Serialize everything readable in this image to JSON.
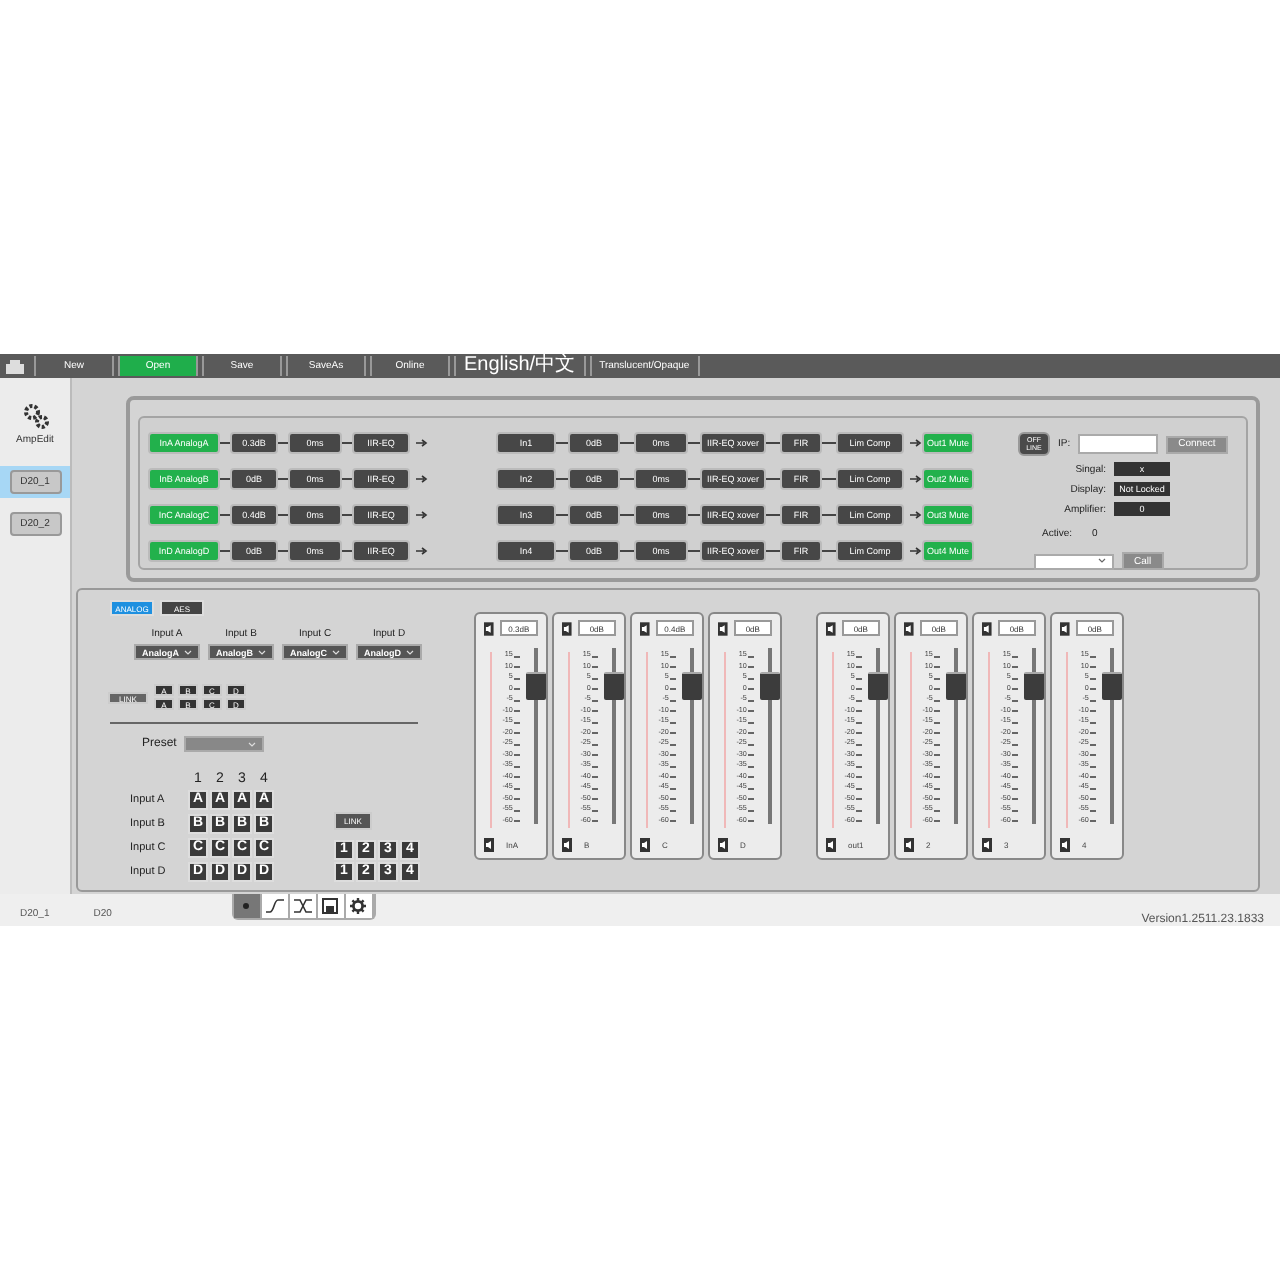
{
  "toolbar": {
    "items": [
      {
        "label": "New",
        "selected": false
      },
      {
        "label": "Open",
        "selected": true
      },
      {
        "label": "Save",
        "selected": false
      },
      {
        "label": "SaveAs",
        "selected": false
      },
      {
        "label": "Online",
        "selected": false
      },
      {
        "label": "English/中文",
        "selected": false
      },
      {
        "label": "Translucent/Opaque",
        "selected": false
      }
    ]
  },
  "sidebar": {
    "app_label": "AmpEdit",
    "devices": [
      {
        "label": "D20_1",
        "selected": true
      },
      {
        "label": "D20_2",
        "selected": false
      }
    ]
  },
  "routing": {
    "inputs": [
      {
        "source": "InA AnalogA",
        "gain": "0.3dB",
        "delay": "0ms",
        "eq": "IIR-EQ"
      },
      {
        "source": "InB AnalogB",
        "gain": "0dB",
        "delay": "0ms",
        "eq": "IIR-EQ"
      },
      {
        "source": "InC AnalogC",
        "gain": "0.4dB",
        "delay": "0ms",
        "eq": "IIR-EQ"
      },
      {
        "source": "InD AnalogD",
        "gain": "0dB",
        "delay": "0ms",
        "eq": "IIR-EQ"
      }
    ],
    "outputs": [
      {
        "input": "In1",
        "gain": "0dB",
        "delay": "0ms",
        "eq": "IIR-EQ xover",
        "fir": "FIR",
        "limiter": "Lim Comp",
        "mute": "Out1 Mute"
      },
      {
        "input": "In2",
        "gain": "0dB",
        "delay": "0ms",
        "eq": "IIR-EQ xover",
        "fir": "FIR",
        "limiter": "Lim Comp",
        "mute": "Out2 Mute"
      },
      {
        "input": "In3",
        "gain": "0dB",
        "delay": "0ms",
        "eq": "IIR-EQ xover",
        "fir": "FIR",
        "limiter": "Lim Comp",
        "mute": "Out3 Mute"
      },
      {
        "input": "In4",
        "gain": "0dB",
        "delay": "0ms",
        "eq": "IIR-EQ xover",
        "fir": "FIR",
        "limiter": "Lim Comp",
        "mute": "Out4 Mute"
      }
    ]
  },
  "connection": {
    "status_button": "OFF LINE",
    "ip_label": "IP:",
    "connect_button": "Connect",
    "fields": [
      {
        "label": "Singal:",
        "value": "x"
      },
      {
        "label": "Display:",
        "value": "Not Locked"
      },
      {
        "label": "Amplifier:",
        "value": "0"
      }
    ],
    "active_label": "Active:",
    "active_value": "0",
    "call_button": "Call"
  },
  "input_panel": {
    "tabs": [
      {
        "label": "ANALOG",
        "selected": true
      },
      {
        "label": "AES",
        "selected": false
      }
    ],
    "inputs": [
      {
        "label": "Input A",
        "value": "AnalogA"
      },
      {
        "label": "Input B",
        "value": "AnalogB"
      },
      {
        "label": "Input C",
        "value": "AnalogC"
      },
      {
        "label": "Input D",
        "value": "AnalogD"
      }
    ],
    "link_button": "LINK",
    "link_rows": [
      [
        "A",
        "B",
        "C",
        "D"
      ],
      [
        "A",
        "B",
        "C",
        "D"
      ]
    ],
    "preset_label": "Preset",
    "matrix": {
      "columns": [
        "1",
        "2",
        "3",
        "4"
      ],
      "rows": [
        {
          "label": "Input A",
          "cells": [
            "A",
            "A",
            "A",
            "A"
          ]
        },
        {
          "label": "Input B",
          "cells": [
            "B",
            "B",
            "B",
            "B"
          ]
        },
        {
          "label": "Input C",
          "cells": [
            "C",
            "C",
            "C",
            "C"
          ]
        },
        {
          "label": "Input D",
          "cells": [
            "D",
            "D",
            "D",
            "D"
          ]
        }
      ]
    },
    "link_label": "LINK",
    "link_groups": [
      [
        "1",
        "2",
        "3",
        "4"
      ],
      [
        "1",
        "2",
        "3",
        "4"
      ]
    ]
  },
  "input_channels": [
    {
      "value": "0.3dB",
      "label": "InA",
      "level": 0.8,
      "ticks": [
        "15",
        "10",
        "5",
        "0",
        "-5",
        "-10",
        "-15",
        "-20",
        "-25",
        "-30",
        "-35",
        "-40",
        "-45",
        "-50",
        "-55",
        "-60"
      ]
    },
    {
      "value": "0dB",
      "label": "B",
      "level": 0.8,
      "ticks": [
        "15",
        "10",
        "5",
        "0",
        "-5",
        "-10",
        "-15",
        "-20",
        "-25",
        "-30",
        "-35",
        "-40",
        "-45",
        "-50",
        "-55",
        "-60"
      ]
    },
    {
      "value": "0.4dB",
      "label": "C",
      "level": 0.8,
      "ticks": [
        "15",
        "10",
        "5",
        "0",
        "-5",
        "-10",
        "-15",
        "-20",
        "-25",
        "-30",
        "-35",
        "-40",
        "-45",
        "-50",
        "-55",
        "-60"
      ]
    },
    {
      "value": "0dB",
      "label": "D",
      "level": 0.8,
      "ticks": [
        "15",
        "10",
        "5",
        "0",
        "-5",
        "-10",
        "-15",
        "-20",
        "-25",
        "-30",
        "-35",
        "-40",
        "-45",
        "-50",
        "-55",
        "-60"
      ]
    }
  ],
  "output_channels": [
    {
      "value": "0dB",
      "label": "out1",
      "level": 0.8,
      "ticks": [
        "15",
        "10",
        "5",
        "0",
        "-5",
        "-10",
        "-15",
        "-20",
        "-25",
        "-30",
        "-35",
        "-40",
        "-45",
        "-50",
        "-55",
        "-60"
      ]
    },
    {
      "value": "0dB",
      "label": "2",
      "level": 0.8,
      "ticks": [
        "15",
        "10",
        "5",
        "0",
        "-5",
        "-10",
        "-15",
        "-20",
        "-25",
        "-30",
        "-35",
        "-40",
        "-45",
        "-50",
        "-55",
        "-60"
      ]
    },
    {
      "value": "0dB",
      "label": "3",
      "level": 0.8,
      "ticks": [
        "15",
        "10",
        "5",
        "0",
        "-5",
        "-10",
        "-15",
        "-20",
        "-25",
        "-30",
        "-35",
        "-40",
        "-45",
        "-50",
        "-55",
        "-60"
      ]
    },
    {
      "value": "0dB",
      "label": "4",
      "level": 0.8,
      "ticks": [
        "15",
        "10",
        "5",
        "0",
        "-5",
        "-10",
        "-15",
        "-20",
        "-25",
        "-30",
        "-35",
        "-40",
        "-45",
        "-50",
        "-55",
        "-60"
      ]
    }
  ],
  "footer": {
    "device": "D20_1",
    "model": "D20",
    "tools": [
      {
        "kind": "dot",
        "selected": true
      },
      {
        "kind": "curve",
        "selected": false
      },
      {
        "kind": "crossover",
        "selected": false
      },
      {
        "kind": "save",
        "selected": false
      },
      {
        "kind": "gear",
        "selected": false
      }
    ],
    "version": "Version1.2511.23.1833"
  }
}
